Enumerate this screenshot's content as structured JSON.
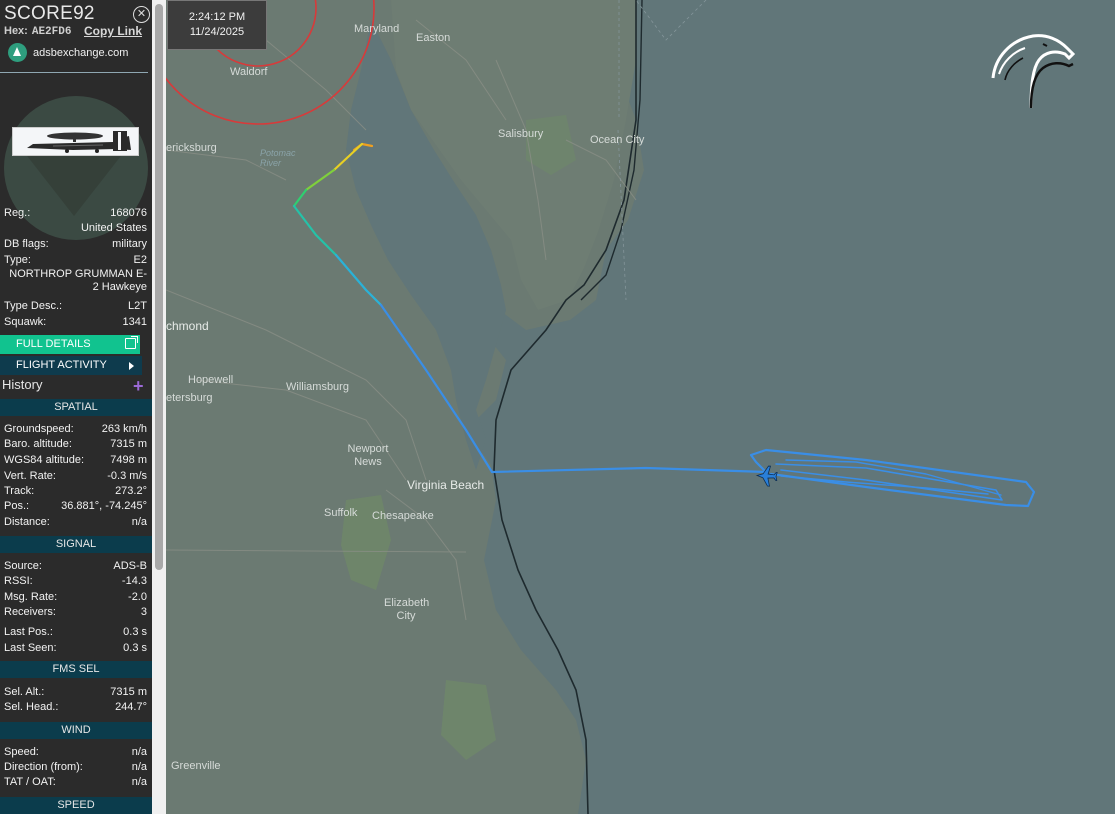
{
  "aircraft": {
    "callsign": "SCORE92",
    "hex_label": "Hex:",
    "hex": "AE2FD6",
    "copy_link": "Copy Link",
    "site": "adsbexchange.com"
  },
  "details": {
    "reg_label": "Reg.:",
    "reg": "168076",
    "country": "United States",
    "db_flags_label": "DB flags:",
    "db_flags": "military",
    "type_label": "Type:",
    "type": "E2",
    "type_name": "NORTHROP GRUMMAN E-2 Hawkeye",
    "type_desc_label": "Type Desc.:",
    "type_desc": "L2T",
    "squawk_label": "Squawk:",
    "squawk": "1341"
  },
  "buttons": {
    "full_details": "FULL DETAILS",
    "flight_activity": "FLIGHT ACTIVITY",
    "history": "History"
  },
  "sections": {
    "spatial": "SPATIAL",
    "signal": "SIGNAL",
    "fms_sel": "FMS SEL",
    "wind": "WIND",
    "speed": "SPEED"
  },
  "spatial": [
    {
      "label": "Groundspeed:",
      "value": "263 km/h"
    },
    {
      "label": "Baro. altitude:",
      "value": "7315 m"
    },
    {
      "label": "WGS84 altitude:",
      "value": "7498 m"
    },
    {
      "label": "Vert. Rate:",
      "value": "-0.3 m/s"
    },
    {
      "label": "Track:",
      "value": "273.2°"
    },
    {
      "label": "Pos.:",
      "value": "36.881°, -74.245°"
    },
    {
      "label": "Distance:",
      "value": "n/a"
    }
  ],
  "signal": [
    {
      "label": "Source:",
      "value": "ADS-B"
    },
    {
      "label": "RSSI:",
      "value": "-14.3"
    },
    {
      "label": "Msg. Rate:",
      "value": "-2.0"
    },
    {
      "label": "Receivers:",
      "value": "3"
    },
    {
      "label": "Last Pos.:",
      "value": "0.3 s"
    },
    {
      "label": "Last Seen:",
      "value": "0.3 s"
    }
  ],
  "fms": [
    {
      "label": "Sel. Alt.:",
      "value": "7315 m"
    },
    {
      "label": "Sel. Head.:",
      "value": "244.7°"
    }
  ],
  "wind": [
    {
      "label": "Speed:",
      "value": "n/a"
    },
    {
      "label": "Direction (from):",
      "value": "n/a"
    },
    {
      "label": "TAT / OAT:",
      "value": "n/a"
    }
  ],
  "clock": {
    "time": "2:24:12 PM",
    "date": "11/24/2025"
  },
  "map": {
    "places": {
      "maryland": "Maryland",
      "easton": "Easton",
      "waldorf": "Waldorf",
      "fredericksburg": "ericksburg",
      "potomac": "Potomac River",
      "salisbury": "Salisbury",
      "ocean_city": "Ocean City",
      "richmond": "chmond",
      "hopewell": "Hopewell",
      "petersburg": "etersburg",
      "williamsburg": "Williamsburg",
      "newport_news": "Newport News",
      "virginia_beach": "Virginia Beach",
      "suffolk": "Suffolk",
      "chesapeake": "Chesapeake",
      "elizabeth_city": "Elizabeth City",
      "greenville": "Greenville"
    }
  },
  "colors": {
    "sidebar_bg": "#2b2b2b",
    "section_head": "#0b3c4c",
    "full_details_btn": "#11c38f",
    "track_blue": "#3a8ee6",
    "range_ring": "#d83a3a",
    "water": "#617679"
  }
}
